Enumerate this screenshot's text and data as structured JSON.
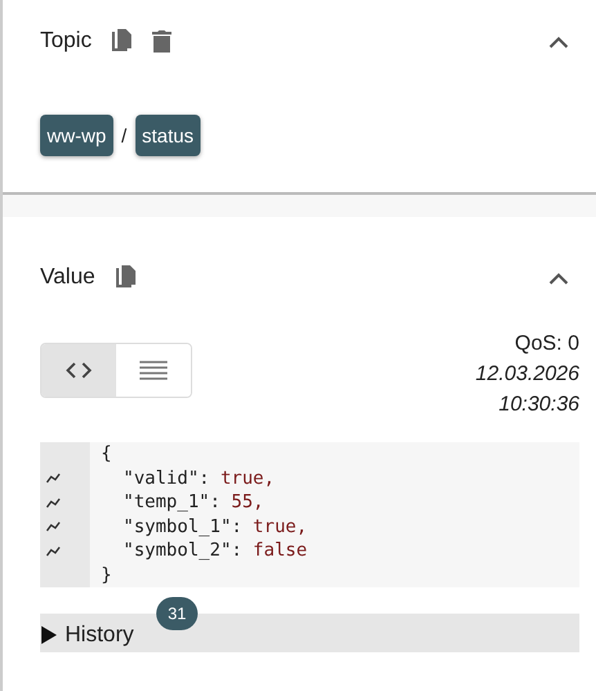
{
  "topic": {
    "title": "Topic",
    "expanded": true,
    "segments": [
      "ww-wp",
      "status"
    ],
    "separator": "/"
  },
  "value": {
    "title": "Value",
    "expanded": true,
    "view_modes": [
      {
        "kind": "code",
        "selected": true
      },
      {
        "kind": "list",
        "selected": false
      }
    ],
    "qos": "QoS: 0",
    "date": "12.03.2026",
    "time": "10:30:36",
    "code_lines": [
      {
        "kind": "brace",
        "text": "{",
        "chart": false
      },
      {
        "kind": "entry",
        "key": "\"valid\":",
        "value": "true,",
        "chart": true
      },
      {
        "kind": "entry",
        "key": "\"temp_1\":",
        "value": "55,",
        "chart": true
      },
      {
        "kind": "entry",
        "key": "\"symbol_1\":",
        "value": "true,",
        "chart": true
      },
      {
        "kind": "entry",
        "key": "\"symbol_2\":",
        "value": "false",
        "chart": true
      },
      {
        "kind": "brace",
        "text": "}",
        "chart": false
      }
    ],
    "history": {
      "label": "History",
      "count": "31",
      "expanded": false
    }
  }
}
